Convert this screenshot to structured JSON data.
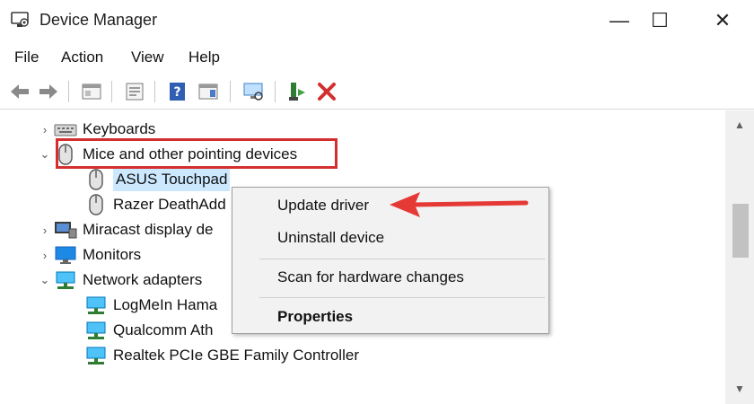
{
  "window": {
    "title": "Device Manager",
    "min_glyph": "—",
    "max_glyph": "☐",
    "close_glyph": "✕"
  },
  "menu": [
    "File",
    "Action",
    "View",
    "Help"
  ],
  "toolbar": {
    "icons": [
      "back-icon",
      "forward-icon",
      "console-icon",
      "properties-icon",
      "help-icon",
      "action-pane-icon",
      "scan-icon",
      "update-driver-icon",
      "uninstall-icon"
    ]
  },
  "tree": [
    {
      "label": "Keyboards",
      "chev": "›",
      "icon": "keyboard-icon"
    },
    {
      "label": "Mice and other pointing devices",
      "chev": "⌄",
      "icon": "mouse-icon"
    },
    {
      "label": "ASUS Touchpad",
      "icon": "mouse-icon"
    },
    {
      "label": "Razer DeathAdd",
      "icon": "mouse-icon"
    },
    {
      "label": "Miracast display de",
      "chev": "›",
      "icon": "display-icon"
    },
    {
      "label": "Monitors",
      "chev": "›",
      "icon": "monitor-icon"
    },
    {
      "label": "Network adapters",
      "chev": "⌄",
      "icon": "network-icon"
    },
    {
      "label": "LogMeIn Hama",
      "icon": "network-icon"
    },
    {
      "label": "Qualcomm Ath",
      "icon": "network-icon"
    },
    {
      "label": "Realtek PCIe GBE Family Controller",
      "icon": "network-icon"
    }
  ],
  "context_menu": {
    "update_driver": "Update driver",
    "uninstall_device": "Uninstall device",
    "scan": "Scan for hardware changes",
    "properties": "Properties"
  },
  "colors": {
    "highlight": "#d32f2f",
    "selection": "#cce8ff",
    "accent_arrow": "#e53935"
  }
}
